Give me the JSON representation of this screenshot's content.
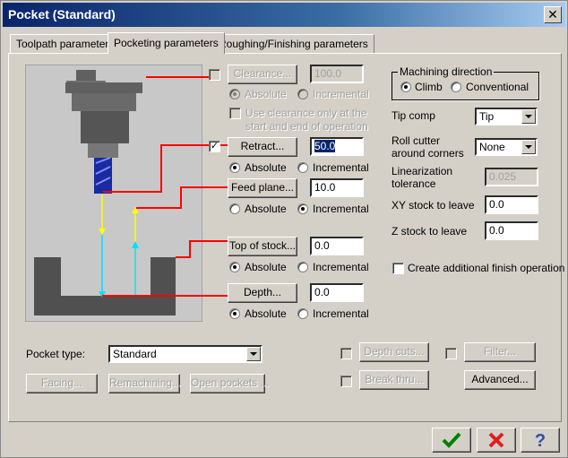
{
  "window": {
    "title": "Pocket (Standard)",
    "close_glyph": "✕"
  },
  "tabs": [
    {
      "label": "Toolpath parameters",
      "active": false
    },
    {
      "label": "Pocketing parameters",
      "active": true
    },
    {
      "label": "Roughing/Finishing parameters",
      "active": false
    }
  ],
  "heights": {
    "clearance": {
      "label": "Clearance...",
      "value": "100.0",
      "enabled": false,
      "checked": false,
      "abs_label": "Absolute",
      "inc_label": "Incremental",
      "mode": "absolute",
      "only_label_1": "Use clearance only at the",
      "only_label_2": "start and end of operation"
    },
    "retract": {
      "label": "Retract...",
      "value": "50.0",
      "checked": true,
      "abs_label": "Absolute",
      "inc_label": "Incremental",
      "mode": "absolute"
    },
    "feed_plane": {
      "label": "Feed plane...",
      "value": "10.0",
      "abs_label": "Absolute",
      "inc_label": "Incremental",
      "mode": "incremental"
    },
    "top_of_stock": {
      "label": "Top of stock...",
      "value": "0.0",
      "abs_label": "Absolute",
      "inc_label": "Incremental",
      "mode": "absolute"
    },
    "depth": {
      "label": "Depth...",
      "value": "0.0",
      "abs_label": "Absolute",
      "inc_label": "Incremental",
      "mode": "absolute"
    }
  },
  "machining_direction": {
    "title": "Machining direction",
    "climb": "Climb",
    "conventional": "Conventional",
    "selected": "climb"
  },
  "right": {
    "tip_comp_label": "Tip comp",
    "tip_comp_value": "Tip",
    "roll_cutter_label_1": "Roll cutter",
    "roll_cutter_label_2": "around corners",
    "roll_cutter_value": "None",
    "linearization_label_1": "Linearization",
    "linearization_label_2": "tolerance",
    "linearization_value": "0.025",
    "xy_stock_label": "XY stock to leave",
    "xy_stock_value": "0.0",
    "z_stock_label": "Z stock to leave",
    "z_stock_value": "0.0",
    "create_finish_label": "Create additional finish operation"
  },
  "bottom": {
    "pocket_type_label": "Pocket type:",
    "pocket_type_value": "Standard",
    "depth_cuts": "Depth cuts...",
    "filter": "Filter...",
    "break_thru": "Break thru...",
    "advanced": "Advanced...",
    "facing": "Facing...",
    "remachining": "Remachining...",
    "open_pockets": "Open pockets ..."
  },
  "colors": {
    "title_start": "#0a246a",
    "ok_check": "#008000",
    "cancel_x": "#e02020",
    "help": "#3050a0",
    "diagram_red": "#ff0000",
    "arrow_yellow": "#ffff00",
    "arrow_cyan": "#00e0ff"
  },
  "footer_icons": [
    "ok-check-icon",
    "cancel-x-icon",
    "help-question-icon"
  ]
}
